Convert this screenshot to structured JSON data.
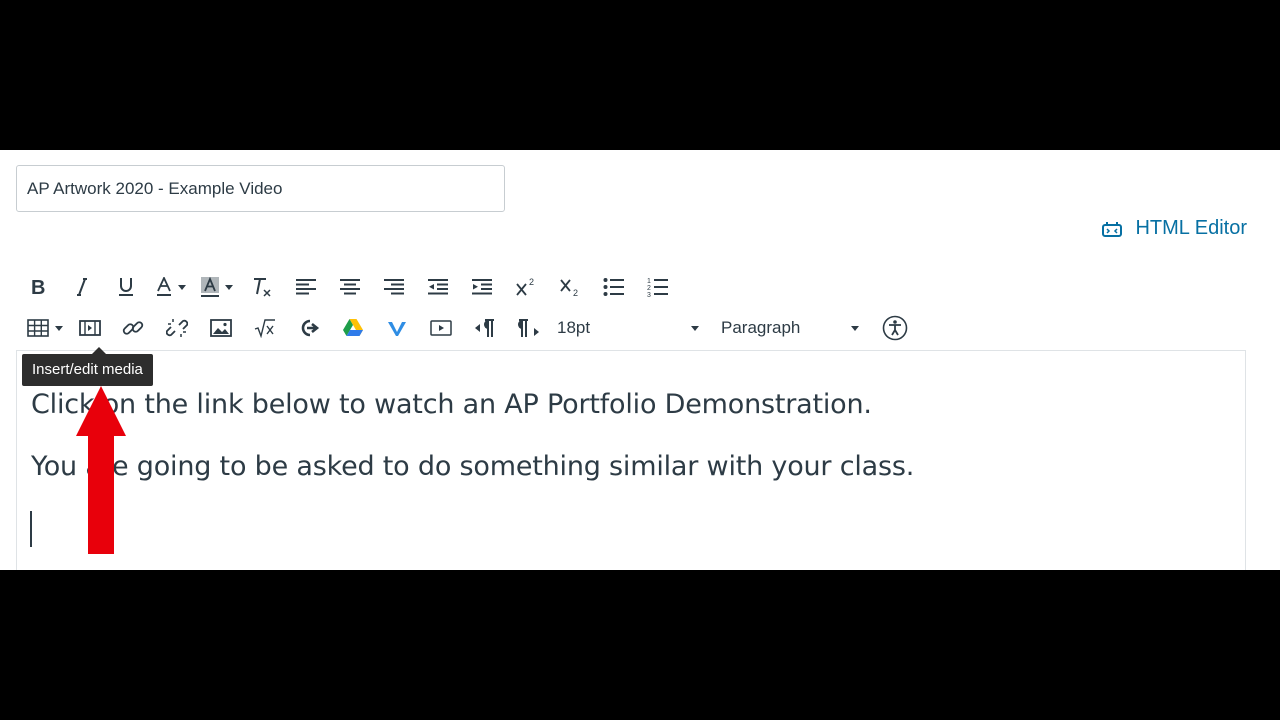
{
  "title_field": {
    "value": "AP Artwork 2020 - Example Video"
  },
  "html_editor": {
    "label": "HTML Editor",
    "icon": "html-editor-icon"
  },
  "toolbar": {
    "row1": [
      "bold",
      "italic",
      "underline",
      "text-color",
      "background-color",
      "clear-formatting",
      "align-left",
      "align-center",
      "align-right",
      "outdent",
      "indent",
      "superscript",
      "subscript",
      "bullet-list",
      "numbered-list"
    ],
    "row2": [
      "table",
      "insert-edit-media",
      "link",
      "unlink",
      "image",
      "equation",
      "external-tools",
      "google-drive",
      "vimeo",
      "media-embed",
      "ltr",
      "rtl",
      "accessibility-checker"
    ],
    "font_size": "18pt",
    "block_format": "Paragraph"
  },
  "tooltip": {
    "text": "Insert/edit media"
  },
  "content": {
    "paragraph1": "Click on the link below to watch an AP Portfolio Demonstration.",
    "paragraph2": "You are going to be asked to do something similar with your class."
  },
  "colors": {
    "accent": "#0770a3",
    "arrow": "#e8000b",
    "text": "#2d3b45",
    "tooltip_bg": "#2d2d2d"
  }
}
